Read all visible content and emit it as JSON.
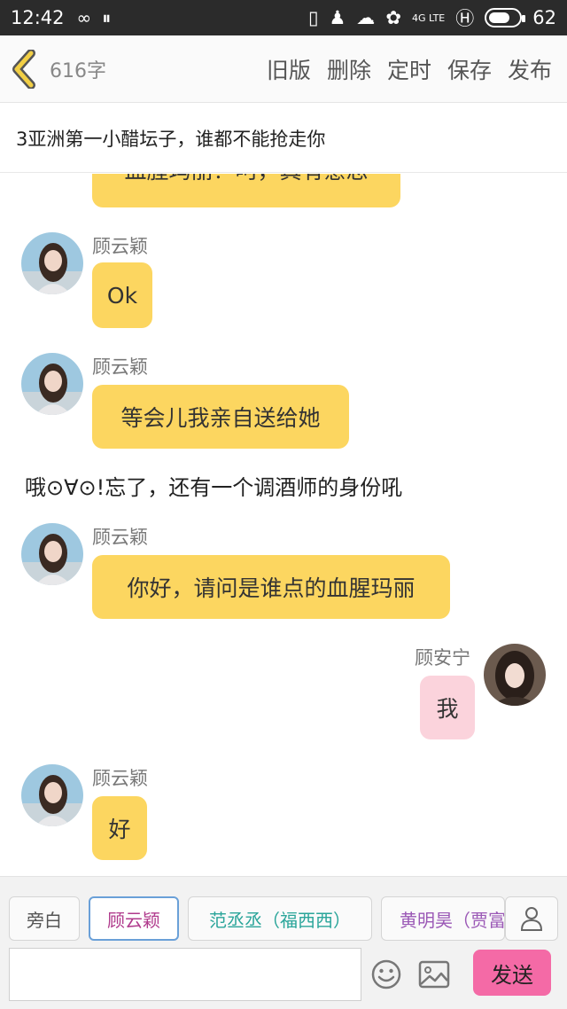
{
  "status_bar": {
    "time": "12:42",
    "network": "4G LTE",
    "battery": "62"
  },
  "toolbar": {
    "word_count": "616字",
    "actions": [
      "旧版",
      "删除",
      "定时",
      "保存",
      "发布"
    ]
  },
  "title": "3亚洲第一小醋坛子，谁都不能抢走你",
  "chat": {
    "partial_message": "血腥玛丽？呵，真有意思",
    "messages": [
      {
        "speaker": "顾云颖",
        "text": "Ok"
      },
      {
        "speaker": "顾云颖",
        "text": "等会儿我亲自送给她"
      },
      {
        "narration": "哦⊙∀⊙!忘了，还有一个调酒师的身份吼"
      },
      {
        "speaker": "顾云颖",
        "text": "你好，请问是谁点的血腥玛丽"
      },
      {
        "speaker": "顾安宁",
        "text": "我"
      },
      {
        "speaker": "顾云颖",
        "text": "好"
      }
    ]
  },
  "characters": [
    {
      "label": "旁白",
      "color": "#555555"
    },
    {
      "label": "顾云颖",
      "color": "#b03a8c"
    },
    {
      "label": "范丞丞（福西西）",
      "color": "#2aa59a"
    },
    {
      "label": "黄明昊（贾富",
      "color": "#9b59b6"
    }
  ],
  "composer": {
    "input_value": "",
    "send_label": "发送"
  },
  "colors": {
    "bubble_partner": "#fcd660",
    "bubble_self": "#fbd3dc",
    "send_button": "#f46aa6",
    "back_arrow": "#e8c23a"
  }
}
